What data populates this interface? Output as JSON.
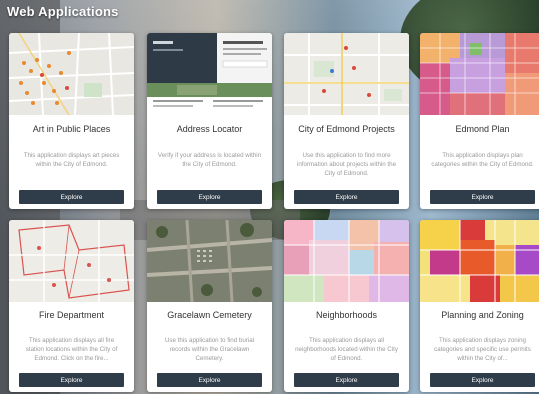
{
  "page": {
    "title": "Web Applications"
  },
  "cards": [
    {
      "title": "Art in Public Places",
      "desc": "This application displays art pieces within the City of Edmond.",
      "button": "Explore"
    },
    {
      "title": "Address Locator",
      "desc": "Verify if your address is located within the City of Edmond.",
      "button": "Explore"
    },
    {
      "title": "City of Edmond Projects",
      "desc": "Use this application to find more information about projects within the City of Edmond.",
      "button": "Explore"
    },
    {
      "title": "Edmond Plan",
      "desc": "This application displays plan categories within the City of Edmond.",
      "button": "Explore"
    },
    {
      "title": "Fire Department",
      "desc": "This application displays all fire station locations within the City of Edmond. Click on the fire...",
      "button": "Explore"
    },
    {
      "title": "Gracelawn Cemetery",
      "desc": "Use this application to find burial records within the Gracelawn Cemetery.",
      "button": "Explore"
    },
    {
      "title": "Neighborhoods",
      "desc": "This application displays all neighborhoods located within the City of Edmond.",
      "button": "Explore"
    },
    {
      "title": "Planning and Zoning",
      "desc": "This application displays zoning categories and specific use permits within the City of...",
      "button": "Explore"
    }
  ],
  "colors": {
    "button_bg": "#2f3d4a",
    "title_text": "#333333",
    "desc_text": "#9a9a9a"
  }
}
